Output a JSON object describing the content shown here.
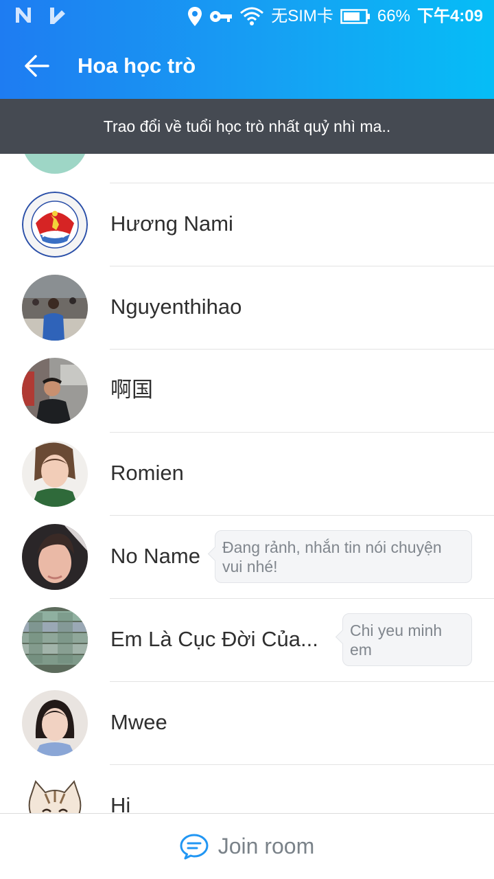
{
  "status_bar": {
    "left_icons": [
      "n-notification-icon",
      "check-notification-icon"
    ],
    "right_icons": [
      "location-icon",
      "key-icon",
      "wifi-icon"
    ],
    "sim_text": "无SIM卡",
    "battery": "66%",
    "time": "下午4:09"
  },
  "header": {
    "back_icon": "arrow-left-icon",
    "title": "Hoa học trò"
  },
  "topic": "Trao đổi về tuổi học trò nhất quỷ nhì ma..",
  "members": [
    {
      "name": "",
      "avatar": "teal-circle"
    },
    {
      "name": "Hương Nami",
      "avatar": "emblem"
    },
    {
      "name": "Nguyenthihao",
      "avatar": "photo-woman-blue"
    },
    {
      "name": "啊国",
      "avatar": "photo-man-kitchen"
    },
    {
      "name": "Romien",
      "avatar": "photo-woman-selfie"
    },
    {
      "name": "No Name",
      "avatar": "photo-young-man",
      "status": "Đang rảnh, nhắn tin nói chuyện vui nhé!"
    },
    {
      "name": "Em Là Cục Đời Của...",
      "avatar": "photo-money",
      "status": "Chi yeu minh em"
    },
    {
      "name": "Mwee",
      "avatar": "photo-girl"
    },
    {
      "name": "Hi",
      "avatar": "cartoon-cat"
    }
  ],
  "join": {
    "icon": "chat-bubble-icon",
    "label": "Join room"
  },
  "colors": {
    "header_start": "#1e7cf2",
    "header_end": "#06bdf6",
    "topic_bg": "#454a52",
    "accent": "#2196f3"
  }
}
